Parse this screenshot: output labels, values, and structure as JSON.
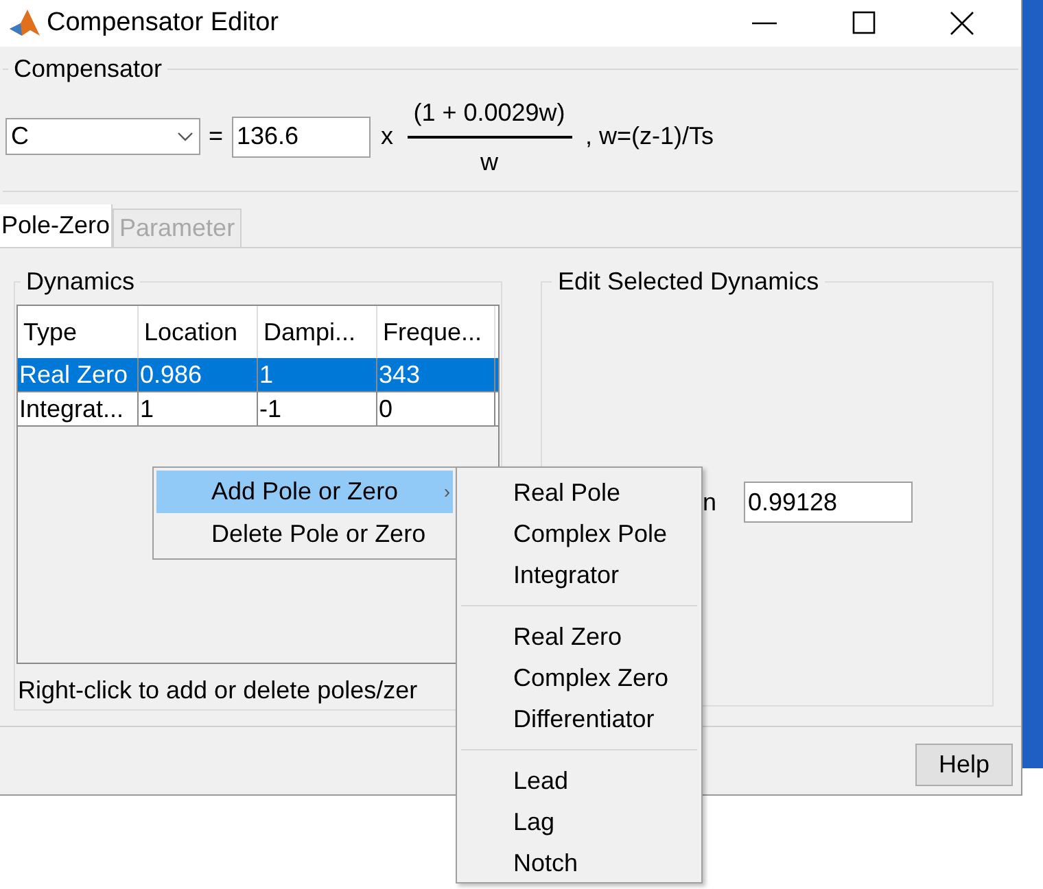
{
  "window": {
    "title": "Compensator Editor"
  },
  "compensator": {
    "group_title": "Compensator",
    "name_value": "C",
    "gain": "136.6",
    "times": "x",
    "numerator": "(1 + 0.0029w)",
    "denominator": "w",
    "equals": "=",
    "suffix": ", w=(z-1)/Ts"
  },
  "tabs": [
    {
      "label": "Pole-Zero",
      "selected": true,
      "disabled": false
    },
    {
      "label": "Parameter",
      "selected": false,
      "disabled": true
    }
  ],
  "dynamics": {
    "group_title": "Dynamics",
    "columns": [
      "Type",
      "Location",
      "Dampi...",
      "Freque..."
    ],
    "rows": [
      {
        "cells": [
          "Real Zero",
          "0.986",
          "1",
          "343"
        ],
        "selected": true
      },
      {
        "cells": [
          "Integrat...",
          "1",
          "-1",
          "0"
        ],
        "selected": false
      }
    ],
    "hint": "Right-click to add or delete poles/zer"
  },
  "edit_selected": {
    "group_title": "Edit Selected Dynamics",
    "label": "n",
    "value": "0.99128"
  },
  "context_menu": {
    "items": [
      {
        "label": "Add Pole or Zero",
        "selected": true,
        "submenu": true
      },
      {
        "label": "Delete Pole or Zero",
        "selected": false,
        "submenu": false
      }
    ],
    "submenu_arrow": "›"
  },
  "submenu": {
    "groups": [
      [
        "Real Pole",
        "Complex Pole",
        "Integrator"
      ],
      [
        "Real Zero",
        "Complex Zero",
        "Differentiator"
      ],
      [
        "Lead",
        "Lag",
        "Notch"
      ]
    ]
  },
  "buttons": [
    "Help"
  ]
}
